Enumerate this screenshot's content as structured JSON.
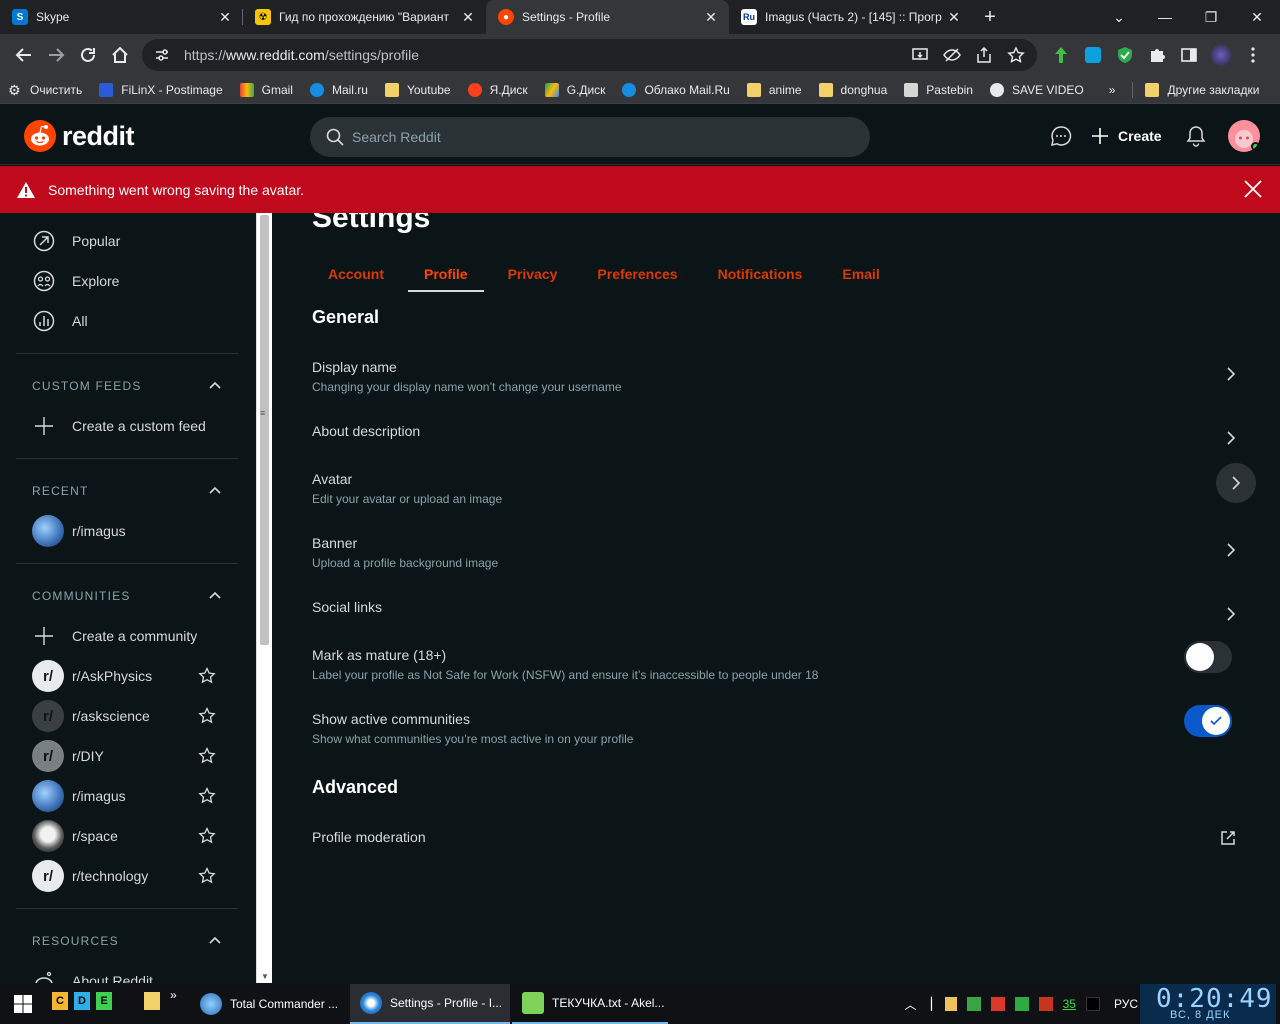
{
  "browser": {
    "tabs": [
      {
        "title": "Skype",
        "active": false
      },
      {
        "title": "Гид по прохождению \"Вариант",
        "active": false
      },
      {
        "title": "Settings - Profile",
        "active": true
      },
      {
        "title": "Imagus (Часть 2) - [145] :: Прогр",
        "active": false
      }
    ],
    "url_prefix": "https://",
    "url_host": "www.reddit.com",
    "url_path": "/settings/profile",
    "bookmarks": [
      "Очистить",
      "FiLinX - Postimage",
      "Gmail",
      "Mail.ru",
      "Youtube",
      "Я.Диск",
      "G.Диск",
      "Облако Mail.Ru",
      "anime",
      "donghua",
      "Pastebin",
      "SAVE VIDEO"
    ],
    "bookmarks_overflow": "»",
    "other_bookmarks": "Другие закладки"
  },
  "header": {
    "logo_text": "reddit",
    "search_placeholder": "Search Reddit",
    "create_label": "Create"
  },
  "banner": {
    "message": "Something went wrong saving the avatar."
  },
  "sidebar": {
    "nav": [
      "Popular",
      "Explore",
      "All"
    ],
    "custom_feeds_header": "CUSTOM FEEDS",
    "create_custom_feed": "Create a custom feed",
    "recent_header": "RECENT",
    "recent": [
      "r/imagus"
    ],
    "communities_header": "COMMUNITIES",
    "create_community": "Create a community",
    "communities": [
      "r/AskPhysics",
      "r/askscience",
      "r/DIY",
      "r/imagus",
      "r/space",
      "r/technology"
    ],
    "resources_header": "RESOURCES",
    "about": "About Reddit"
  },
  "main": {
    "title": "Settings",
    "tabs": [
      "Account",
      "Profile",
      "Privacy",
      "Preferences",
      "Notifications",
      "Email"
    ],
    "active_tab": "Profile",
    "general_title": "General",
    "rows": [
      {
        "label": "Display name",
        "desc": "Changing your display name won’t change your username"
      },
      {
        "label": "About description",
        "desc": ""
      },
      {
        "label": "Avatar",
        "desc": "Edit your avatar or upload an image"
      },
      {
        "label": "Banner",
        "desc": "Upload a profile background image"
      },
      {
        "label": "Social links",
        "desc": ""
      }
    ],
    "toggles": [
      {
        "label": "Mark as mature (18+)",
        "desc": "Label your profile as Not Safe for Work (NSFW) and ensure it’s inaccessible to people under 18",
        "on": false
      },
      {
        "label": "Show active communities",
        "desc": "Show what communities you’re most active in on your profile",
        "on": true
      }
    ],
    "advanced_title": "Advanced",
    "moderation_label": "Profile moderation"
  },
  "taskbar": {
    "apps": [
      "Total Commander ...",
      "Settings - Profile - I...",
      "ТЕКУЧКА.txt - Akel..."
    ],
    "quick_launch": [
      "C",
      "D",
      "E"
    ],
    "tray_count": "35",
    "lang": "РУС",
    "time": "0:20:49",
    "date": "ВС, 8  ДЕК"
  },
  "colors": {
    "accent": "#ff4500",
    "banner": "#c1091d",
    "bg": "#0b1416",
    "toggle_on": "#0a58c9"
  }
}
